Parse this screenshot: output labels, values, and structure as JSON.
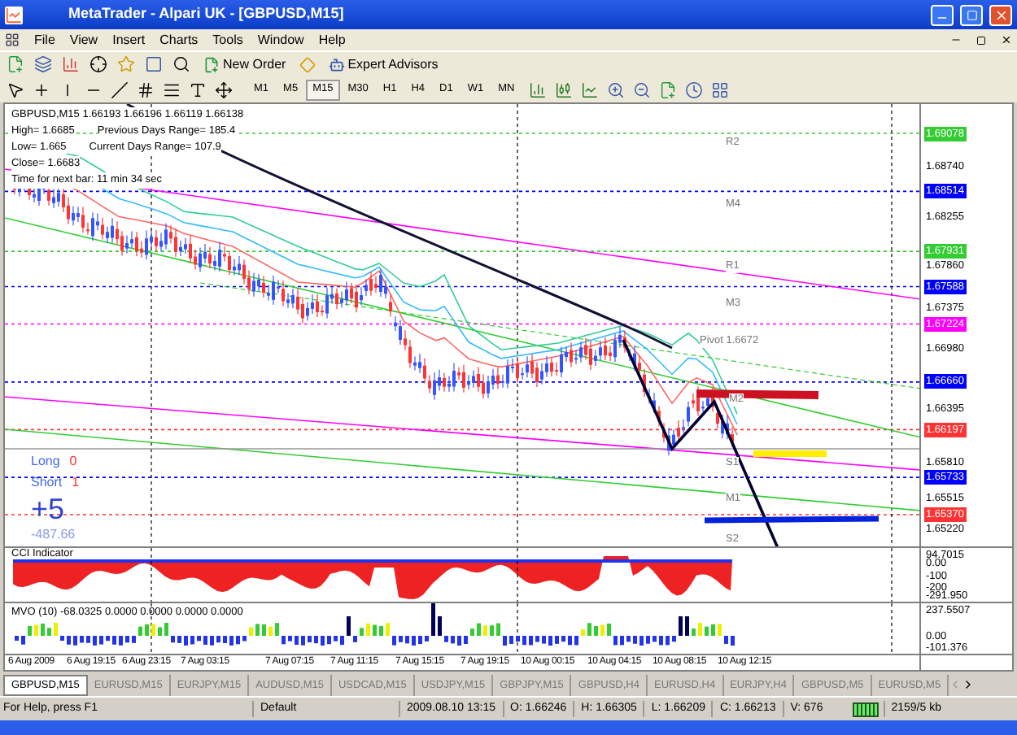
{
  "window": {
    "title": "MetaTrader - Alpari UK - [GBPUSD,M15]"
  },
  "menu": [
    "File",
    "View",
    "Insert",
    "Charts",
    "Tools",
    "Window",
    "Help"
  ],
  "toolbar": {
    "buttons": [
      "New Order",
      "Expert Advisors"
    ]
  },
  "timeframes": [
    {
      "label": "M1",
      "selected": false
    },
    {
      "label": "M5",
      "selected": false
    },
    {
      "label": "M15",
      "selected": true
    },
    {
      "label": "M30",
      "selected": false
    },
    {
      "label": "H1",
      "selected": false
    },
    {
      "label": "H4",
      "selected": false
    },
    {
      "label": "D1",
      "selected": false
    },
    {
      "label": "W1",
      "selected": false
    },
    {
      "label": "MN",
      "selected": false
    }
  ],
  "chart": {
    "info": [
      "GBPUSD,M15  1.66193 1.66196 1.66119 1.66138",
      "High= 1.6685",
      "Previous Days Range= 185.4",
      "Low= 1.665",
      "Current Days Range= 107.9",
      "Close= 1.6683",
      "Time for next bar: 11 min 34 sec"
    ],
    "levels": [
      "R2",
      "M4",
      "R1",
      "M3",
      "Pivot  1.6672",
      "M2",
      "S1",
      "M1",
      "S2"
    ],
    "trade": {
      "long_label": "Long",
      "long_value": "0",
      "short_label": "Short",
      "short_value": "1",
      "pips": "+5",
      "profit": "-487.66"
    },
    "price_axis": [
      {
        "kind": "tag",
        "price": "1.69078",
        "color": "#33cc33"
      },
      {
        "kind": "tick",
        "price": "1.68740"
      },
      {
        "kind": "tag",
        "price": "1.68514",
        "color": "#0000ff"
      },
      {
        "kind": "tick",
        "price": "1.68255"
      },
      {
        "kind": "tag",
        "price": "1.67931",
        "color": "#33cc33"
      },
      {
        "kind": "tick",
        "price": "1.67860"
      },
      {
        "kind": "tag",
        "price": "1.67588",
        "color": "#0000ff"
      },
      {
        "kind": "tick",
        "price": "1.67375"
      },
      {
        "kind": "tag",
        "price": "1.67224",
        "color": "#ff00ff"
      },
      {
        "kind": "tick",
        "price": "1.66980"
      },
      {
        "kind": "tag",
        "price": "1.66660",
        "color": "#0000ff"
      },
      {
        "kind": "tick",
        "price": "1.66395"
      },
      {
        "kind": "tag",
        "price": "1.66197",
        "color": "#ff3333"
      },
      {
        "kind": "tick",
        "price": "1.65810"
      },
      {
        "kind": "tag",
        "price": "1.65733",
        "color": "#0000ff"
      },
      {
        "kind": "tick",
        "price": "1.65515"
      },
      {
        "kind": "tag",
        "price": "1.65370",
        "color": "#ff3333"
      },
      {
        "kind": "tick",
        "price": "1.65220"
      }
    ]
  },
  "cci": {
    "title": "CCI Indicator",
    "axis": [
      "94.7015",
      "0.00",
      "-100",
      "-200",
      "-291.950"
    ]
  },
  "mvo": {
    "title": "MVO (10) -68.0325 0.0000 0.0000 0.0000 0.0000",
    "axis": [
      "237.5507",
      "0.00",
      "-101.376"
    ]
  },
  "time_axis": [
    "6 Aug 2009",
    "6 Aug 19:15",
    "6 Aug 23:15",
    "7 Aug 03:15",
    "7 Aug 07:15",
    "7 Aug 11:15",
    "7 Aug 15:15",
    "7 Aug 19:15",
    "10 Aug 00:15",
    "10 Aug 04:15",
    "10 Aug 08:15",
    "10 Aug 12:15"
  ],
  "tabs": [
    {
      "label": "GBPUSD,M15",
      "selected": true
    },
    {
      "label": "EURUSD,M15",
      "selected": false
    },
    {
      "label": "EURJPY,M15",
      "selected": false
    },
    {
      "label": "AUDUSD,M15",
      "selected": false
    },
    {
      "label": "USDCAD,M15",
      "selected": false
    },
    {
      "label": "USDJPY,M15",
      "selected": false
    },
    {
      "label": "GBPJPY,M15",
      "selected": false
    },
    {
      "label": "GBPUSD,H4",
      "selected": false
    },
    {
      "label": "EURUSD,H4",
      "selected": false
    },
    {
      "label": "EURJPY,H4",
      "selected": false
    },
    {
      "label": "GBPUSD,M5",
      "selected": false
    },
    {
      "label": "EURUSD,M5",
      "selected": false
    }
  ],
  "status_bar": {
    "help": "For Help, press F1",
    "profile": "Default",
    "time": "2009.08.10 13:15",
    "open": "O: 1.66246",
    "high": "H: 1.66305",
    "low": "L: 1.66209",
    "close": "C: 1.66213",
    "volume": "V: 676",
    "traffic": "2159/5 kb"
  }
}
